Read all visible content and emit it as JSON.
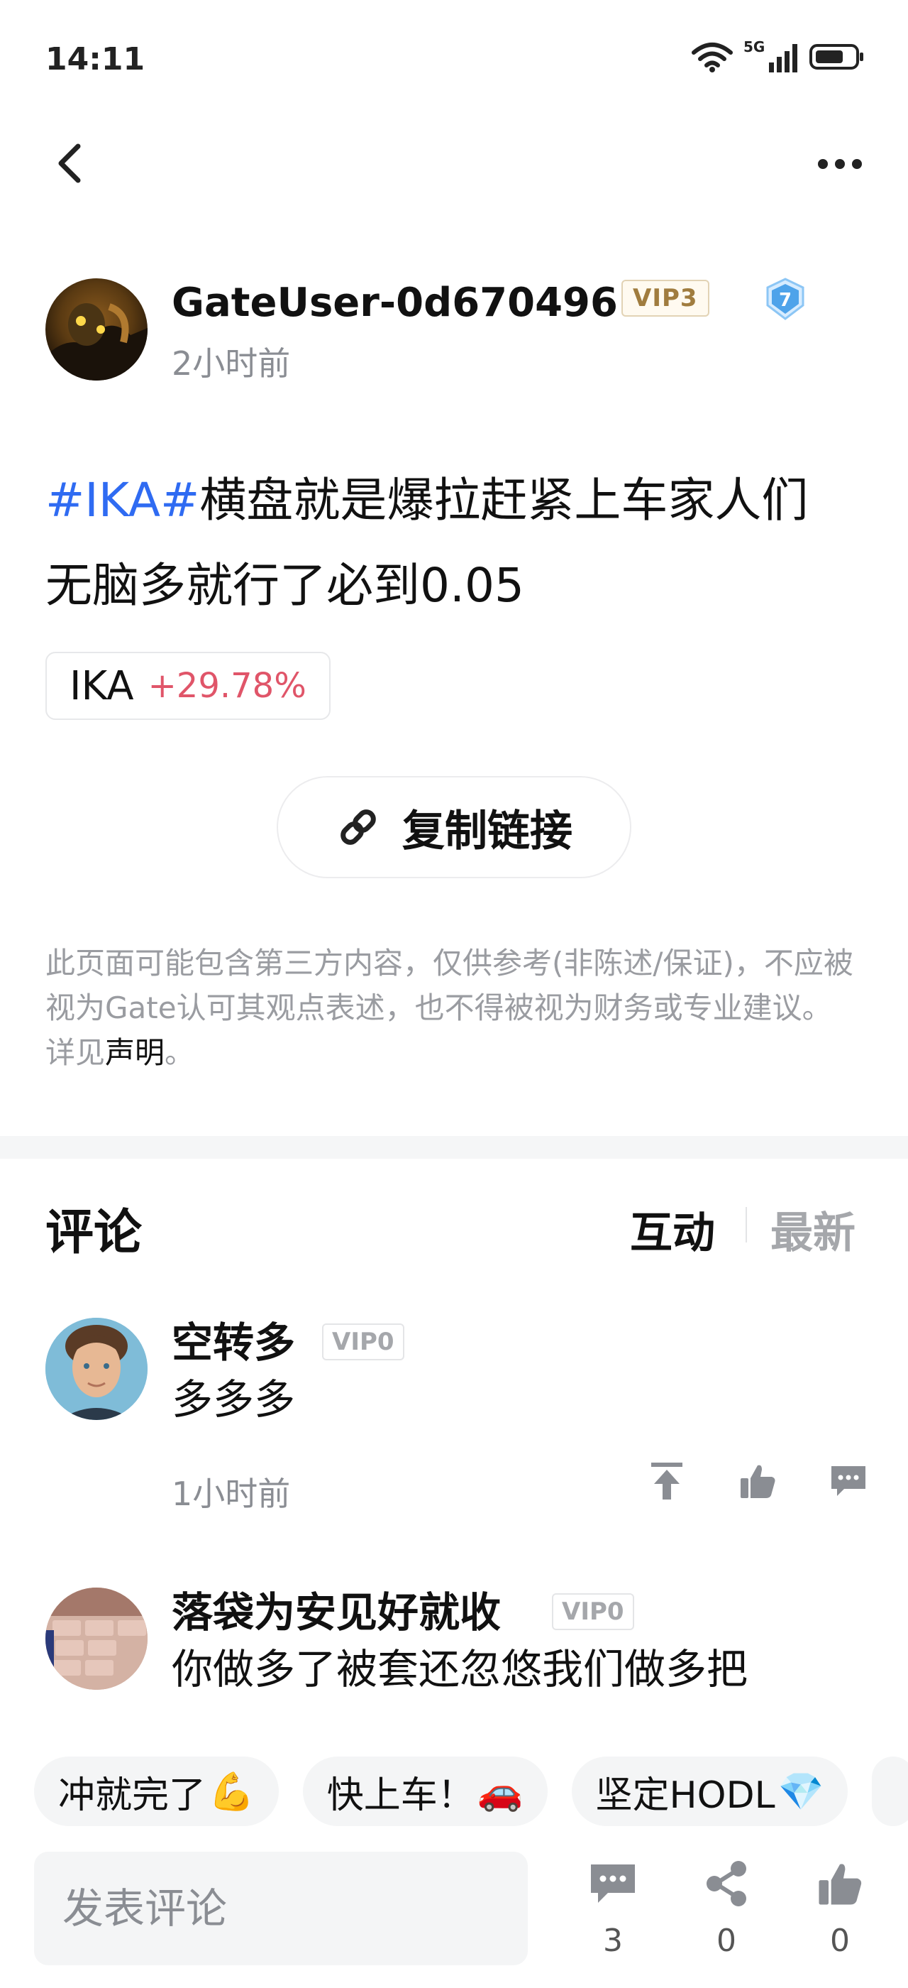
{
  "status_bar": {
    "time": "14:11",
    "network": "5G"
  },
  "nav": {
    "back_icon": "chevron-left-icon",
    "more_icon": "more-horizontal-icon"
  },
  "post": {
    "author": "GateUser-0d670496",
    "vip": "VIP3",
    "level": "7",
    "time": "2小时前",
    "hashtag": "#IKA#",
    "body": "横盘就是爆拉赶紧上车家人们 无脑多就行了必到0.05",
    "token": {
      "symbol": "IKA",
      "change": "+29.78%"
    },
    "copy_link_label": "复制链接"
  },
  "disclaimer": {
    "text": "此页面可能包含第三方内容，仅供参考(非陈述/保证)，不应被视为Gate认可其观点表述，也不得被视为财务或专业建议。详见",
    "link": "声明",
    "end": "。"
  },
  "comments": {
    "title": "评论",
    "sort_hot": "互动",
    "sort_new": "最新",
    "items": [
      {
        "name": "空转多",
        "vip": "VIP0",
        "text": "多多多",
        "time": "1小时前"
      },
      {
        "name": "落袋为安见好就收",
        "vip": "VIP0",
        "text": "你做多了被套还忽悠我们做多把"
      }
    ]
  },
  "quick_replies": [
    {
      "text": "冲就完了",
      "emoji": "💪"
    },
    {
      "text": "快上车！",
      "emoji": "🚗"
    },
    {
      "text": "坚定HODL",
      "emoji": "💎"
    }
  ],
  "bottom_bar": {
    "input_placeholder": "发表评论",
    "comment_count": "3",
    "share_count": "0",
    "like_count": "0"
  },
  "colors": {
    "accent": "#2f6bf2",
    "positive_change": "#e05569",
    "muted": "#8a8d93",
    "vip_gold": "#a07c3e"
  }
}
